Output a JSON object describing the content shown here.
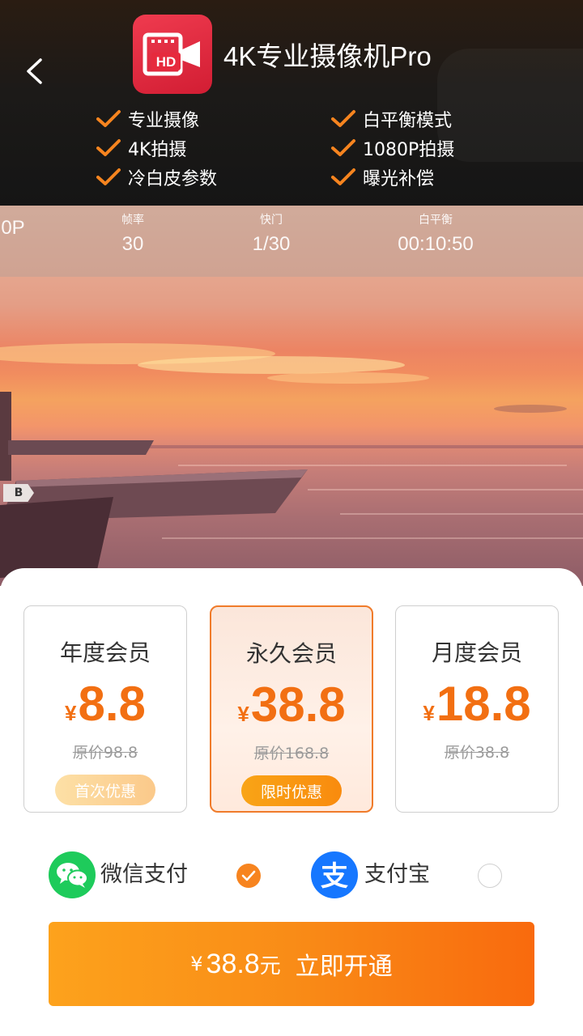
{
  "header": {
    "title": "4K专业摄像机Pro",
    "icon_name": "camera-hd-app-icon",
    "back_icon": "chevron-left-icon",
    "features": [
      "专业摄像",
      "白平衡模式",
      "4K拍摄",
      "1080P拍摄",
      "冷白皮参数",
      "曝光补偿"
    ]
  },
  "preview": {
    "osd": [
      {
        "label": "",
        "value": "0P"
      },
      {
        "label": "帧率",
        "value": "30"
      },
      {
        "label": "快门",
        "value": "1/30"
      },
      {
        "label": "白平衡",
        "value": "00:10:50"
      }
    ],
    "tag": "B"
  },
  "plans": [
    {
      "name": "年度会员",
      "currency": "¥",
      "price": "8.8",
      "original": "原价98.8",
      "badge": "首次优惠",
      "selected": false
    },
    {
      "name": "永久会员",
      "currency": "¥",
      "price": "38.8",
      "original": "原价168.8",
      "badge": "限时优惠",
      "selected": true
    },
    {
      "name": "月度会员",
      "currency": "¥",
      "price": "18.8",
      "original": "原价38.8",
      "badge": "",
      "selected": false
    }
  ],
  "payment": {
    "wechat": {
      "label": "微信支付",
      "icon": "wechat-icon",
      "selected": true
    },
    "alipay": {
      "label": "支付宝",
      "icon": "alipay-icon",
      "selected": false
    }
  },
  "cta": {
    "currency": "¥",
    "amount": "38.8",
    "unit": "元",
    "action": "立即开通"
  },
  "colors": {
    "accent": "#f7841f",
    "price": "#f26f12",
    "wechat": "#1ecb5b",
    "alipay": "#1677ff"
  }
}
